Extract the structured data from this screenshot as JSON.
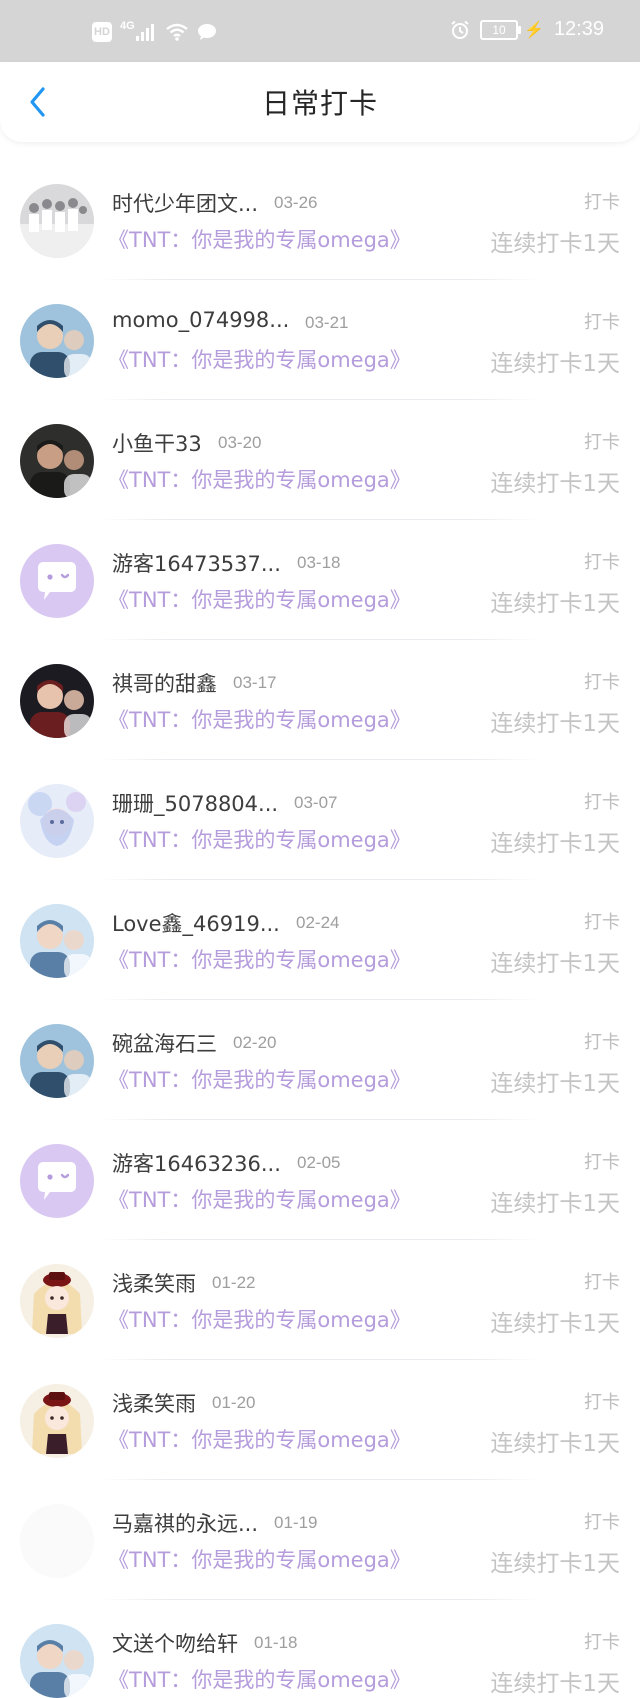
{
  "status_bar": {
    "hd": "HD",
    "network": "4G",
    "battery": "10",
    "time": "12:39"
  },
  "header": {
    "title": "日常打卡"
  },
  "colors": {
    "accent": "#b59cdc",
    "back_arrow": "#2196f3"
  },
  "entries": [
    {
      "user": "时代少年团文...",
      "date": "03-26",
      "book": "《TNT：你是我的专属omega》",
      "tag": "打卡",
      "streak": "连续打卡1天",
      "avatar": "photo-group-avatar"
    },
    {
      "user": "momo_074998...",
      "date": "03-21",
      "book": "《TNT：你是我的专属omega》",
      "tag": "打卡",
      "streak": "连续打卡1天",
      "avatar": "photo-avatar"
    },
    {
      "user": "小鱼干33",
      "date": "03-20",
      "book": "《TNT：你是我的专属omega》",
      "tag": "打卡",
      "streak": "连续打卡1天",
      "avatar": "photo-avatar"
    },
    {
      "user": "游客16473537...",
      "date": "03-18",
      "book": "《TNT：你是我的专属omega》",
      "tag": "打卡",
      "streak": "连续打卡1天",
      "avatar": "guest-chat-avatar"
    },
    {
      "user": "祺哥的甜鑫",
      "date": "03-17",
      "book": "《TNT：你是我的专属omega》",
      "tag": "打卡",
      "streak": "连续打卡1天",
      "avatar": "photo-avatar"
    },
    {
      "user": "珊珊_5078804...",
      "date": "03-07",
      "book": "《TNT：你是我的专属omega》",
      "tag": "打卡",
      "streak": "连续打卡1天",
      "avatar": "illustration-avatar"
    },
    {
      "user": "Love鑫_46919...",
      "date": "02-24",
      "book": "《TNT：你是我的专属omega》",
      "tag": "打卡",
      "streak": "连续打卡1天",
      "avatar": "photo-avatar"
    },
    {
      "user": "碗盆海石三",
      "date": "02-20",
      "book": "《TNT：你是我的专属omega》",
      "tag": "打卡",
      "streak": "连续打卡1天",
      "avatar": "photo-avatar"
    },
    {
      "user": "游客16463236...",
      "date": "02-05",
      "book": "《TNT：你是我的专属omega》",
      "tag": "打卡",
      "streak": "连续打卡1天",
      "avatar": "guest-chat-avatar"
    },
    {
      "user": "浅柔笑雨",
      "date": "01-22",
      "book": "《TNT：你是我的专属omega》",
      "tag": "打卡",
      "streak": "连续打卡1天",
      "avatar": "illustration-avatar"
    },
    {
      "user": "浅柔笑雨",
      "date": "01-20",
      "book": "《TNT：你是我的专属omega》",
      "tag": "打卡",
      "streak": "连续打卡1天",
      "avatar": "illustration-avatar"
    },
    {
      "user": "马嘉祺的永远...",
      "date": "01-19",
      "book": "《TNT：你是我的专属omega》",
      "tag": "打卡",
      "streak": "连续打卡1天",
      "avatar": "blank-avatar"
    },
    {
      "user": "文送个吻给轩",
      "date": "01-18",
      "book": "《TNT：你是我的专属omega》",
      "tag": "打卡",
      "streak": "连续打卡1天",
      "avatar": "photo-avatar"
    }
  ]
}
